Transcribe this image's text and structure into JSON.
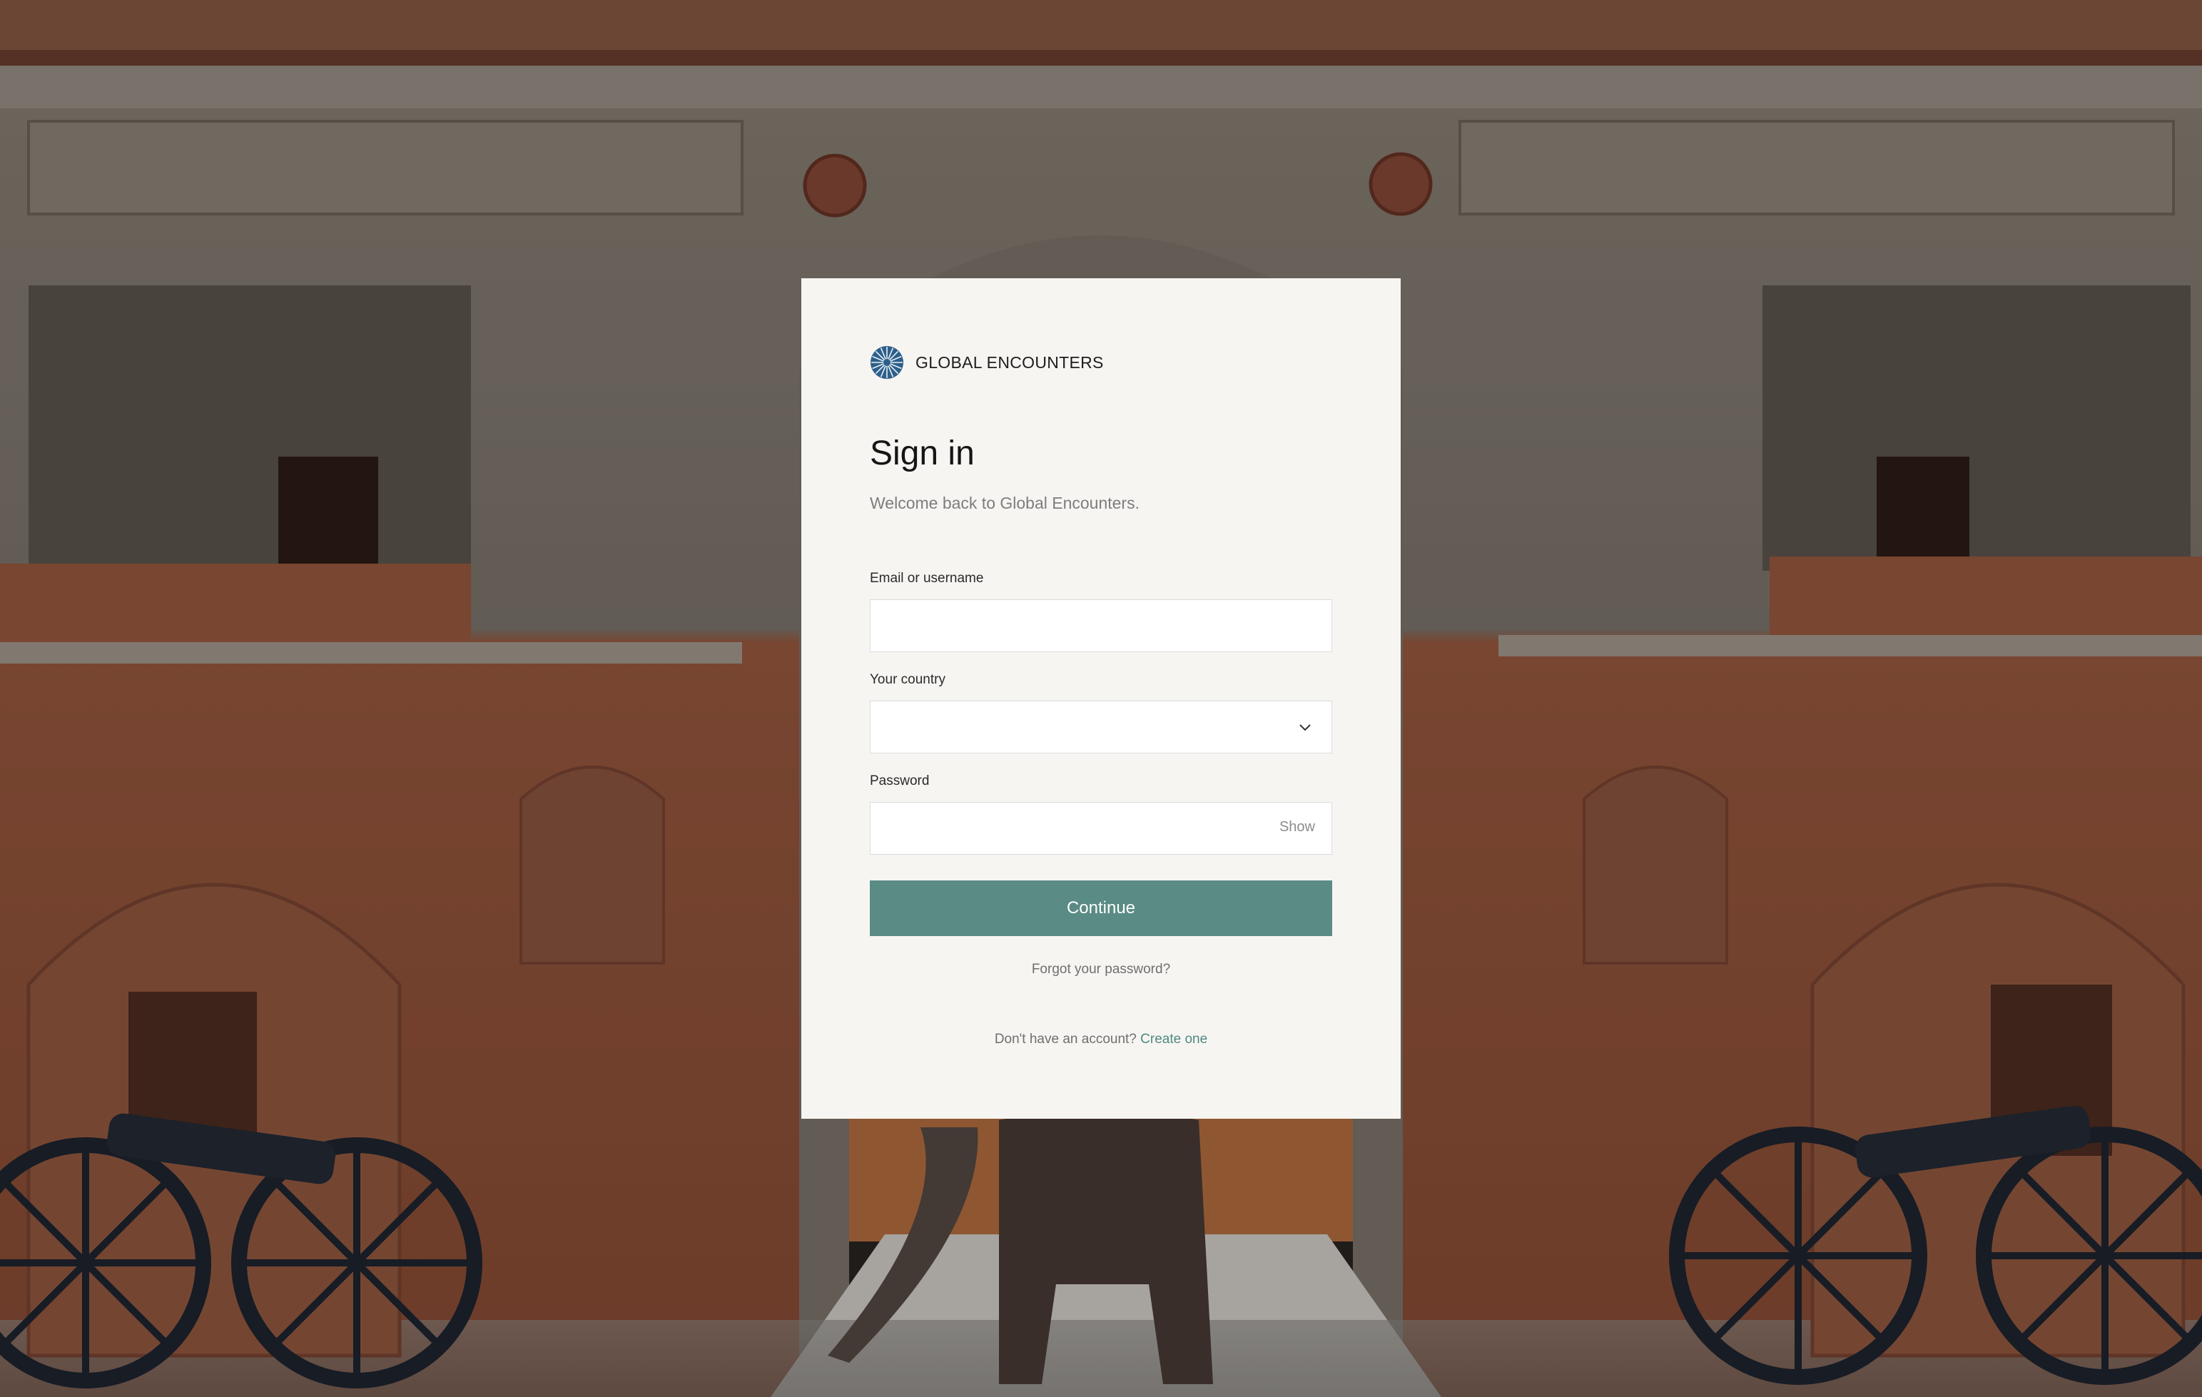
{
  "brand": {
    "name": "GLOBAL ENCOUNTERS",
    "logo_icon": "starburst-logo-icon",
    "logo_color": "#2d5f8a"
  },
  "signin": {
    "title": "Sign in",
    "subtitle": "Welcome back to Global Encounters."
  },
  "form": {
    "email_label": "Email or username",
    "email_value": "",
    "country_label": "Your country",
    "country_value": "",
    "country_icon": "chevron-down-icon",
    "password_label": "Password",
    "password_value": "",
    "show_label": "Show",
    "continue_label": "Continue",
    "continue_color": "#5a8b84"
  },
  "links": {
    "forgot": "Forgot your password?",
    "no_account": "Don't have an account?",
    "create": "Create one",
    "link_color": "#4f8a82"
  },
  "background": {
    "scene": "palace-gate-photo"
  }
}
